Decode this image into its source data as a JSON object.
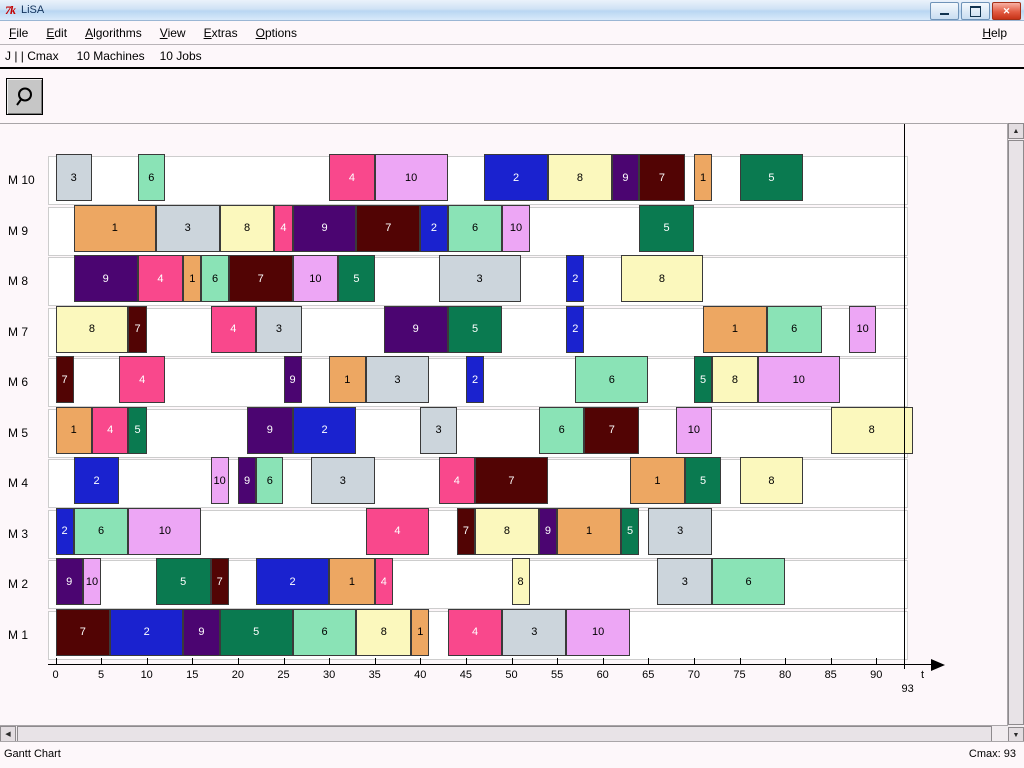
{
  "window": {
    "title": "LiSA",
    "logo": "7k",
    "controls": [
      {
        "name": "minimize",
        "label": "–"
      },
      {
        "name": "restore",
        "label": "❐"
      },
      {
        "name": "close",
        "label": "✕"
      }
    ]
  },
  "menu": {
    "items": [
      "File",
      "Edit",
      "Algorithms",
      "View",
      "Extras",
      "Options"
    ],
    "help": "Help"
  },
  "problem": {
    "notation": "J | | Cmax",
    "machines": "10 Machines",
    "jobs": "10 Jobs"
  },
  "toolbar": {
    "zoom_icon": "magnifier-icon"
  },
  "ruler": {
    "ticks": [
      0,
      5,
      10,
      15,
      20,
      25,
      30,
      35,
      40,
      45,
      50,
      55,
      60,
      65,
      70,
      75,
      80,
      85,
      90
    ],
    "end_label": "93"
  },
  "axis": {
    "ticks": [
      0,
      5,
      10,
      15,
      20,
      25,
      30,
      35,
      40,
      45,
      50,
      55,
      60,
      65,
      70,
      75,
      80,
      85,
      90
    ],
    "cmax_label": "93",
    "time_label": "t"
  },
  "status": {
    "left": "Gantt Chart",
    "right": "Cmax: 93"
  },
  "job_colors": {
    "1": "#eda762",
    "2": "#1a22cf",
    "3": "#ccd5dc",
    "4": "#f9488c",
    "5": "#0a7a50",
    "6": "#8ae3b6",
    "7": "#520404",
    "8": "#fbf8bd",
    "9": "#4b0571",
    "10": "#eda6f5"
  },
  "job_text_colors": {
    "1": "#000000",
    "2": "#ffffff",
    "3": "#000000",
    "4": "#ffffff",
    "5": "#ffffff",
    "6": "#000000",
    "7": "#ffffff",
    "8": "#000000",
    "9": "#ffffff",
    "10": "#000000"
  },
  "chart_data": {
    "type": "gantt",
    "title": "Gantt Chart",
    "xlabel": "t",
    "ylabel": "",
    "xlim": [
      0,
      93
    ],
    "makespan": 93,
    "machine_labels": [
      "M 10",
      "M 9",
      "M 8",
      "M 7",
      "M 6",
      "M 5",
      "M 4",
      "M 3",
      "M 2",
      "M 1"
    ],
    "rows": [
      {
        "machine": "M 10",
        "ops": [
          {
            "job": "3",
            "start": 0,
            "end": 4
          },
          {
            "job": "6",
            "start": 9,
            "end": 12
          },
          {
            "job": "4",
            "start": 30,
            "end": 35
          },
          {
            "job": "10",
            "start": 35,
            "end": 43
          },
          {
            "job": "2",
            "start": 47,
            "end": 54
          },
          {
            "job": "8",
            "start": 54,
            "end": 61
          },
          {
            "job": "9",
            "start": 61,
            "end": 64
          },
          {
            "job": "7",
            "start": 64,
            "end": 69
          },
          {
            "job": "1",
            "start": 70,
            "end": 72
          },
          {
            "job": "5",
            "start": 75,
            "end": 82
          }
        ]
      },
      {
        "machine": "M 9",
        "ops": [
          {
            "job": "1",
            "start": 2,
            "end": 11
          },
          {
            "job": "3",
            "start": 11,
            "end": 18
          },
          {
            "job": "8",
            "start": 18,
            "end": 24
          },
          {
            "job": "4",
            "start": 24,
            "end": 26
          },
          {
            "job": "9",
            "start": 26,
            "end": 33
          },
          {
            "job": "7",
            "start": 33,
            "end": 40
          },
          {
            "job": "2",
            "start": 40,
            "end": 43
          },
          {
            "job": "6",
            "start": 43,
            "end": 49
          },
          {
            "job": "10",
            "start": 49,
            "end": 52
          },
          {
            "job": "5",
            "start": 64,
            "end": 70
          }
        ]
      },
      {
        "machine": "M 8",
        "ops": [
          {
            "job": "9",
            "start": 2,
            "end": 9
          },
          {
            "job": "4",
            "start": 9,
            "end": 14
          },
          {
            "job": "1",
            "start": 14,
            "end": 16
          },
          {
            "job": "6",
            "start": 16,
            "end": 19
          },
          {
            "job": "7",
            "start": 19,
            "end": 26
          },
          {
            "job": "10",
            "start": 26,
            "end": 31
          },
          {
            "job": "5",
            "start": 31,
            "end": 35
          },
          {
            "job": "3",
            "start": 42,
            "end": 51
          },
          {
            "job": "2",
            "start": 56,
            "end": 58
          },
          {
            "job": "8",
            "start": 62,
            "end": 71
          }
        ]
      },
      {
        "machine": "M 7",
        "ops": [
          {
            "job": "8",
            "start": 0,
            "end": 8
          },
          {
            "job": "7",
            "start": 8,
            "end": 10
          },
          {
            "job": "4",
            "start": 17,
            "end": 22
          },
          {
            "job": "3",
            "start": 22,
            "end": 27
          },
          {
            "job": "9",
            "start": 36,
            "end": 43
          },
          {
            "job": "5",
            "start": 43,
            "end": 49
          },
          {
            "job": "2",
            "start": 56,
            "end": 58
          },
          {
            "job": "1",
            "start": 71,
            "end": 78
          },
          {
            "job": "6",
            "start": 78,
            "end": 84
          },
          {
            "job": "10",
            "start": 87,
            "end": 90
          }
        ]
      },
      {
        "machine": "M 6",
        "ops": [
          {
            "job": "7",
            "start": 0,
            "end": 2
          },
          {
            "job": "4",
            "start": 7,
            "end": 12
          },
          {
            "job": "9",
            "start": 25,
            "end": 27
          },
          {
            "job": "1",
            "start": 30,
            "end": 34
          },
          {
            "job": "3",
            "start": 34,
            "end": 41
          },
          {
            "job": "2",
            "start": 45,
            "end": 47
          },
          {
            "job": "6",
            "start": 57,
            "end": 65
          },
          {
            "job": "5",
            "start": 70,
            "end": 72
          },
          {
            "job": "8",
            "start": 72,
            "end": 77
          },
          {
            "job": "10",
            "start": 77,
            "end": 86
          }
        ]
      },
      {
        "machine": "M 5",
        "ops": [
          {
            "job": "1",
            "start": 0,
            "end": 4
          },
          {
            "job": "4",
            "start": 4,
            "end": 8
          },
          {
            "job": "5",
            "start": 8,
            "end": 10
          },
          {
            "job": "9",
            "start": 21,
            "end": 26
          },
          {
            "job": "2",
            "start": 26,
            "end": 33
          },
          {
            "job": "3",
            "start": 40,
            "end": 44
          },
          {
            "job": "6",
            "start": 53,
            "end": 58
          },
          {
            "job": "7",
            "start": 58,
            "end": 64
          },
          {
            "job": "10",
            "start": 68,
            "end": 72
          },
          {
            "job": "8",
            "start": 85,
            "end": 94
          }
        ]
      },
      {
        "machine": "M 4",
        "ops": [
          {
            "job": "2",
            "start": 2,
            "end": 7
          },
          {
            "job": "10",
            "start": 17,
            "end": 19
          },
          {
            "job": "9",
            "start": 20,
            "end": 22
          },
          {
            "job": "6",
            "start": 22,
            "end": 25
          },
          {
            "job": "3",
            "start": 28,
            "end": 35
          },
          {
            "job": "4",
            "start": 42,
            "end": 46
          },
          {
            "job": "7",
            "start": 46,
            "end": 54
          },
          {
            "job": "1",
            "start": 63,
            "end": 69
          },
          {
            "job": "5",
            "start": 69,
            "end": 73
          },
          {
            "job": "8",
            "start": 75,
            "end": 82
          }
        ]
      },
      {
        "machine": "M 3",
        "ops": [
          {
            "job": "2",
            "start": 0,
            "end": 2
          },
          {
            "job": "6",
            "start": 2,
            "end": 8
          },
          {
            "job": "10",
            "start": 8,
            "end": 16
          },
          {
            "job": "4",
            "start": 34,
            "end": 41
          },
          {
            "job": "7",
            "start": 44,
            "end": 46
          },
          {
            "job": "8",
            "start": 46,
            "end": 53
          },
          {
            "job": "9",
            "start": 53,
            "end": 55
          },
          {
            "job": "1",
            "start": 55,
            "end": 62
          },
          {
            "job": "5",
            "start": 62,
            "end": 64
          },
          {
            "job": "3",
            "start": 65,
            "end": 72
          }
        ]
      },
      {
        "machine": "M 2",
        "ops": [
          {
            "job": "9",
            "start": 0,
            "end": 3
          },
          {
            "job": "10",
            "start": 3,
            "end": 5
          },
          {
            "job": "5",
            "start": 11,
            "end": 17
          },
          {
            "job": "7",
            "start": 17,
            "end": 19
          },
          {
            "job": "2",
            "start": 22,
            "end": 30
          },
          {
            "job": "1",
            "start": 30,
            "end": 35
          },
          {
            "job": "4",
            "start": 35,
            "end": 37
          },
          {
            "job": "8",
            "start": 50,
            "end": 52
          },
          {
            "job": "3",
            "start": 66,
            "end": 72
          },
          {
            "job": "6",
            "start": 72,
            "end": 80
          }
        ]
      },
      {
        "machine": "M 1",
        "ops": [
          {
            "job": "7",
            "start": 0,
            "end": 6
          },
          {
            "job": "2",
            "start": 6,
            "end": 14
          },
          {
            "job": "9",
            "start": 14,
            "end": 18
          },
          {
            "job": "5",
            "start": 18,
            "end": 26
          },
          {
            "job": "6",
            "start": 26,
            "end": 33
          },
          {
            "job": "8",
            "start": 33,
            "end": 39
          },
          {
            "job": "1",
            "start": 39,
            "end": 41
          },
          {
            "job": "4",
            "start": 43,
            "end": 49
          },
          {
            "job": "3",
            "start": 49,
            "end": 56
          },
          {
            "job": "10",
            "start": 56,
            "end": 63
          }
        ]
      }
    ]
  }
}
